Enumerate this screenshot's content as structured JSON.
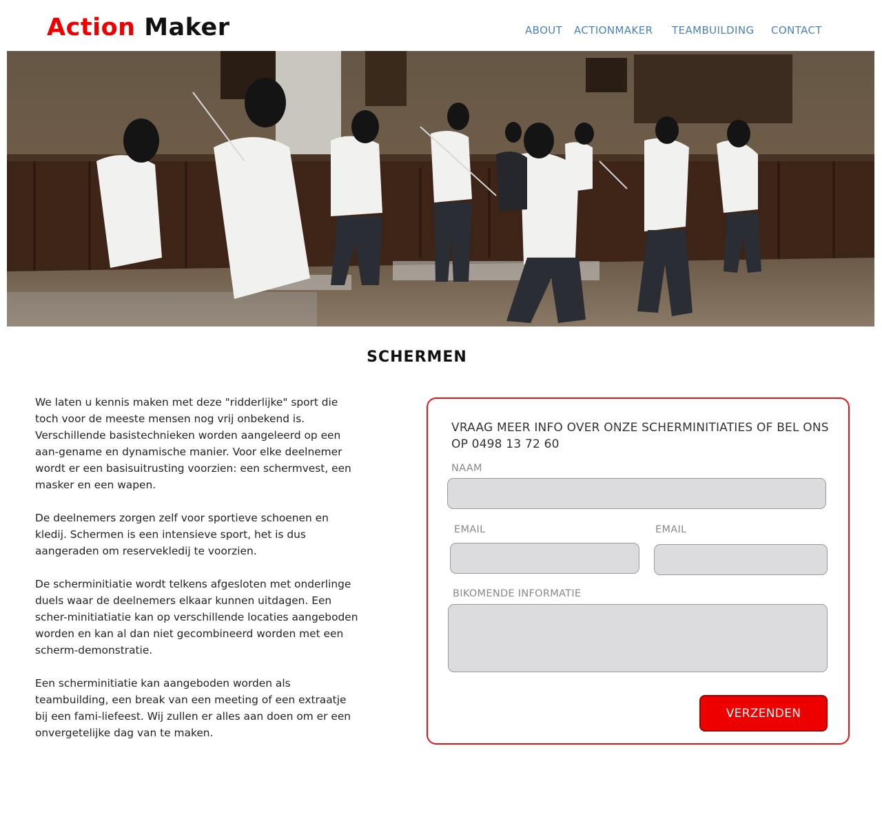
{
  "header": {
    "logo": {
      "word1": "Action",
      "word2": "Maker"
    },
    "nav": [
      {
        "label": "ABOUT"
      },
      {
        "label": "ACTIONMAKER"
      },
      {
        "label": "TEAMBUILDING"
      },
      {
        "label": "CONTACT"
      }
    ]
  },
  "main": {
    "title": "SCHERMEN",
    "paragraphs": [
      "We laten u kennis maken met deze \"ridderlijke\" sport die toch voor de meeste mensen nog vrij onbekend is. Verschillende basistechnieken worden aangeleerd op een aan-gename en dynamische manier. Voor elke deelnemer wordt er een basisuitrusting voorzien: een schermvest, een masker en een wapen.",
      "De deelnemers zorgen zelf voor sportieve schoenen en kledij. Schermen is een intensieve sport, het is dus aangeraden om reservekledij te voorzien.",
      "De scherminitiatie wordt telkens afgesloten met onderlinge duels waar de deelnemers elkaar kunnen uitdagen. Een scher-minitiatiatie kan op verschillende locaties aangeboden worden en kan al dan niet gecombineerd worden met een scherm-demonstratie.",
      "Een scherminitiatie kan aangeboden worden als teambuilding, een break van een meeting of een extraatje bij een fami-liefeest. Wij zullen er alles aan doen om er een onvergetelijke dag van te maken."
    ]
  },
  "form": {
    "heading": "VRAAG MEER INFO OVER ONZE SCHERMINITIATIES OF BEL ONS OP 0498 13 72 60",
    "name_label": "NAAM",
    "name_value": "",
    "email1_label": "EMAIL",
    "email1_value": "",
    "email2_label": "EMAIL",
    "email2_value": "",
    "info_label": "BIKOMENDE INFORMATIE",
    "info_value": "",
    "submit_label": "VERZENDEN"
  },
  "colors": {
    "brand_red": "#ee0000",
    "nav_blue": "#4a7fc0",
    "field_bg": "#dcdcde"
  },
  "hero_image": {
    "alt": "fencing-class-photo"
  }
}
